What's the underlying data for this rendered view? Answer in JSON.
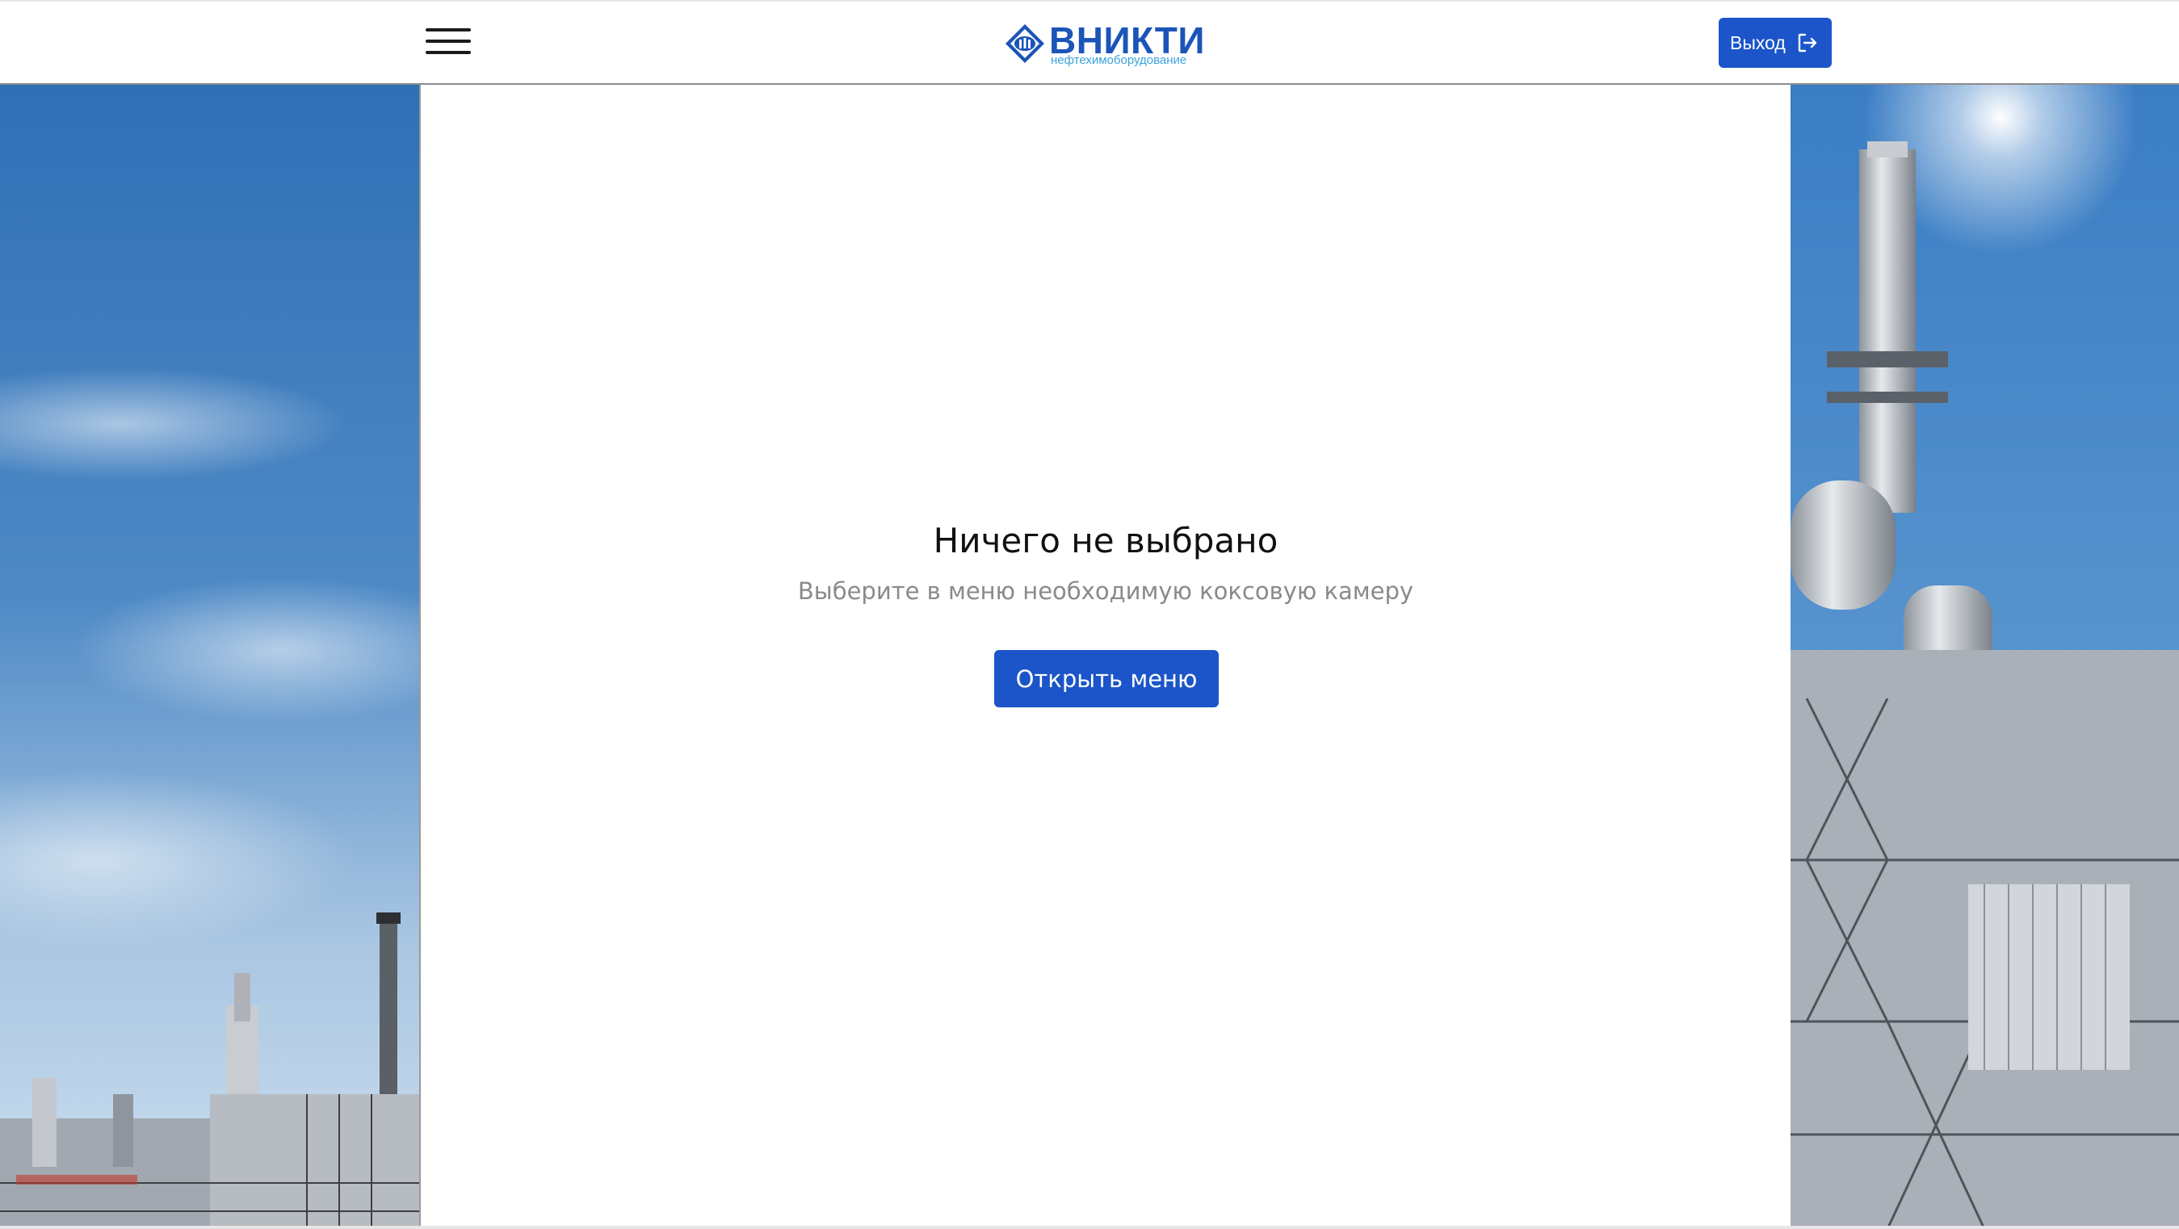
{
  "header": {
    "logo_title": "ВНИКТИ",
    "logo_subtitle": "нефтехимоборудование",
    "logout_label": "Выход"
  },
  "main": {
    "empty_title": "Ничего не выбрано",
    "empty_subtitle": "Выберите в меню необходимую коксовую камеру",
    "open_menu_label": "Открыть меню"
  },
  "icons": {
    "menu": "hamburger-icon",
    "logo": "vnikti-logo-icon",
    "logout": "logout-icon"
  },
  "colors": {
    "primary": "#1b55c9",
    "logo_blue": "#1b55b8",
    "logo_sub": "#3aa3dd",
    "muted_text": "#8a8a8a"
  }
}
